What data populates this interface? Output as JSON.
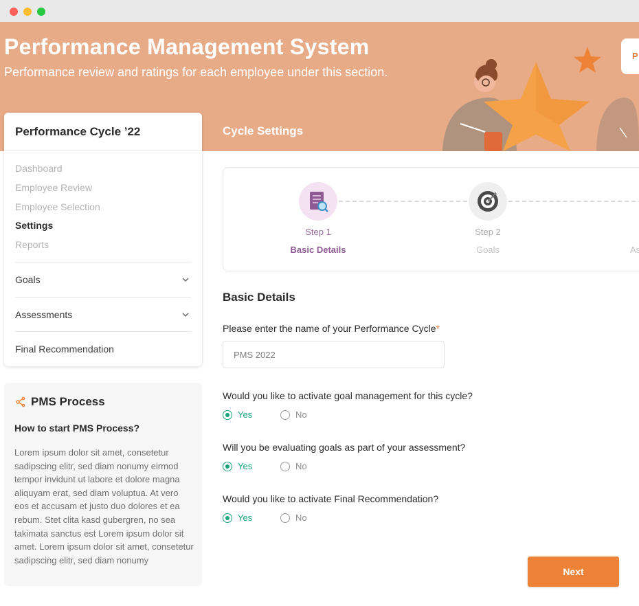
{
  "window": {
    "controls": [
      "close",
      "minimize",
      "maximize"
    ]
  },
  "header": {
    "title": "Performance Management System",
    "subtitle": "Performance review and ratings for each employee under this section.",
    "section_title": "Cycle Settings",
    "corner_label": "P",
    "background_color": "#e8ab88"
  },
  "sidebar": {
    "title": "Performance Cycle ’22",
    "nav": [
      "Dashboard",
      "Employee Review",
      "Employee Selection",
      "Settings",
      "Reports"
    ],
    "active": "Settings",
    "accordion": [
      {
        "label": "Goals",
        "icon": "chevron-down-icon"
      },
      {
        "label": "Assessments",
        "icon": "chevron-down-icon"
      },
      {
        "label": "Final Recommendation"
      }
    ]
  },
  "process": {
    "icon": "share-icon",
    "title": "PMS Process",
    "subtitle": "How to start PMS Process?",
    "body": "Lorem ipsum dolor sit amet, consetetur sadipscing elitr, sed diam nonumy eirmod tempor invidunt ut labore et dolore magna aliquyam erat, sed diam voluptua. At vero eos et accusam et justo duo dolores et ea rebum. Stet clita kasd gubergren, no sea takimata sanctus est Lorem ipsum dolor sit amet. Lorem ipsum dolor sit amet, consetetur sadipscing elitr, sed diam nonumy"
  },
  "stepper": {
    "steps": [
      {
        "label": "Step 1",
        "name": "Basic Details",
        "icon": "document-search-icon",
        "active": true
      },
      {
        "label": "Step 2",
        "name": "Goals",
        "icon": "target-icon",
        "active": false
      },
      {
        "label": "",
        "name": "As",
        "active": false
      }
    ]
  },
  "form": {
    "section_title": "Basic Details",
    "name_label": "Please enter the name of your Performance Cycle",
    "required_mark": "*",
    "name_value": "PMS 2022",
    "questions": [
      {
        "text": "Would you like to activate goal management for this cycle?",
        "yes": "Yes",
        "no": "No",
        "selected": "Yes"
      },
      {
        "text": "Will you be evaluating goals as part of your assessment?",
        "yes": "Yes",
        "no": "No",
        "selected": "Yes"
      },
      {
        "text": "Would you like to activate Final Recommendation?",
        "yes": "Yes",
        "no": "No",
        "selected": "Yes"
      }
    ],
    "next_label": "Next"
  },
  "colors": {
    "accent": "#ee8236",
    "success": "#1aa37a",
    "step_active": "#8e5a94"
  }
}
